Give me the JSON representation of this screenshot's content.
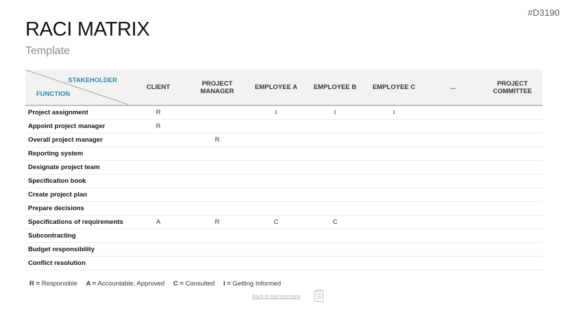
{
  "page_id": "#D3190",
  "title": "RACI MATRIX",
  "subtitle": "Template",
  "table": {
    "corner_top": "STAKEHOLDER",
    "corner_bottom": "FUNCTION",
    "columns": [
      {
        "line1": "CLIENT",
        "line2": ""
      },
      {
        "line1": "PROJECT",
        "line2": "MANAGER"
      },
      {
        "line1": "EMPLOYEE A",
        "line2": ""
      },
      {
        "line1": "EMPLOYEE B",
        "line2": ""
      },
      {
        "line1": "EMPLOYEE C",
        "line2": ""
      },
      {
        "line1": "...",
        "line2": ""
      },
      {
        "line1": "PROJECT",
        "line2": "COMMITTEE"
      }
    ],
    "rows": [
      {
        "function": "Project assignment",
        "cells": [
          "R",
          "",
          "I",
          "I",
          "I",
          "",
          ""
        ]
      },
      {
        "function": "Appoint project manager",
        "cells": [
          "R",
          "",
          "",
          "",
          "",
          "",
          ""
        ]
      },
      {
        "function": "Overall project manager",
        "cells": [
          "",
          "R",
          "",
          "",
          "",
          "",
          ""
        ]
      },
      {
        "function": "Reporting system",
        "cells": [
          "",
          "",
          "",
          "",
          "",
          "",
          ""
        ]
      },
      {
        "function": "Designate project team",
        "cells": [
          "",
          "",
          "",
          "",
          "",
          "",
          ""
        ]
      },
      {
        "function": "Specification book",
        "cells": [
          "",
          "",
          "",
          "",
          "",
          "",
          ""
        ]
      },
      {
        "function": "Create project plan",
        "cells": [
          "",
          "",
          "",
          "",
          "",
          "",
          ""
        ]
      },
      {
        "function": "Prepare decisions",
        "cells": [
          "",
          "",
          "",
          "",
          "",
          "",
          ""
        ]
      },
      {
        "function": "Specifications of requirements",
        "cells": [
          "A",
          "R",
          "C",
          "C",
          "",
          "",
          ""
        ]
      },
      {
        "function": "Subcontracting",
        "cells": [
          "",
          "",
          "",
          "",
          "",
          "",
          ""
        ]
      },
      {
        "function": "Budget responsibility",
        "cells": [
          "",
          "",
          "",
          "",
          "",
          "",
          ""
        ]
      },
      {
        "function": "Conflict resolution",
        "cells": [
          "",
          "",
          "",
          "",
          "",
          "",
          ""
        ]
      }
    ]
  },
  "legend": [
    {
      "key": "R =",
      "text": "Responsible"
    },
    {
      "key": "A =",
      "text": "Accountable, Approved"
    },
    {
      "key": "C =",
      "text": "Consulted"
    },
    {
      "key": "I =",
      "text": "Getting Informed"
    }
  ],
  "back_link": "Back to tool overview",
  "icons": {
    "clipboard": "clipboard-icon"
  },
  "colors": {
    "accent": "#2e86ab",
    "header_bg": "#f2f2f2"
  }
}
